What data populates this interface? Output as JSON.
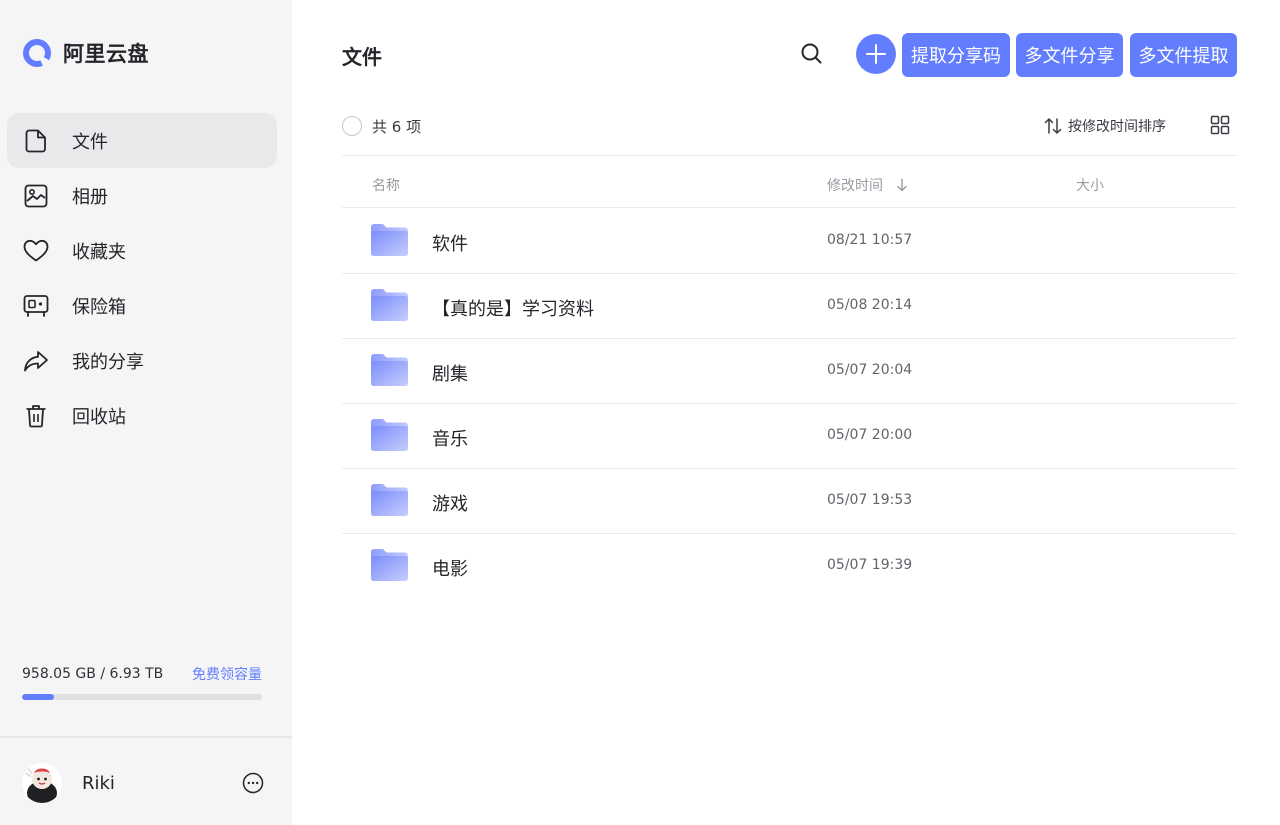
{
  "brand": {
    "name": "阿里云盘",
    "color": "#637dff"
  },
  "sidebar": {
    "items": [
      {
        "label": "文件",
        "icon": "file-icon",
        "active": true
      },
      {
        "label": "相册",
        "icon": "photo-album-icon"
      },
      {
        "label": "收藏夹",
        "icon": "heart-icon"
      },
      {
        "label": "保险箱",
        "icon": "safe-icon"
      },
      {
        "label": "我的分享",
        "icon": "share-icon"
      },
      {
        "label": "回收站",
        "icon": "trash-icon"
      }
    ],
    "storage": {
      "used": "958.05 GB / 6.93 TB",
      "link": "免费领容量",
      "fraction": 0.135
    },
    "user": {
      "name": "Riki",
      "avatar_icon": "user-avatar-icon",
      "more_icon": "more-dots-icon"
    }
  },
  "header": {
    "title": "文件",
    "search_icon": "search-icon",
    "add_icon": "plus-icon",
    "buttons": [
      "提取分享码",
      "多文件分享",
      "多文件提取"
    ]
  },
  "toolbar": {
    "count": "共 6 项",
    "sort_label": "按修改时间排序",
    "sort_icon": "sort-arrows-icon",
    "grid_icon": "grid-view-icon"
  },
  "table": {
    "columns": [
      "名称",
      "修改时间",
      "大小"
    ],
    "rows": [
      {
        "name": "软件",
        "time": "08/21 10:57",
        "icon": "folder-icon"
      },
      {
        "name": "【真的是】学习资料",
        "time": "05/08 20:14",
        "icon": "folder-icon"
      },
      {
        "name": "剧集",
        "time": "05/07 20:04",
        "icon": "folder-icon"
      },
      {
        "name": "音乐",
        "time": "05/07 20:00",
        "icon": "folder-icon"
      },
      {
        "name": "游戏",
        "time": "05/07 19:53",
        "icon": "folder-icon"
      },
      {
        "name": "电影",
        "time": "05/07 19:39",
        "icon": "folder-icon"
      }
    ]
  }
}
